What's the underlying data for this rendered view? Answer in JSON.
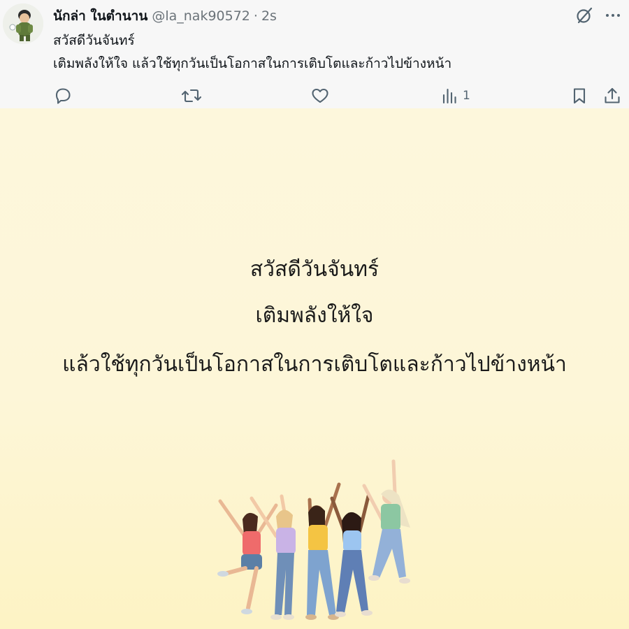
{
  "post": {
    "author": "นักล่า ในตำนาน",
    "handle": "@la_nak90572",
    "separator": "·",
    "time": "2s",
    "text_line1": "สวัสดีวันจันทร์",
    "text_line2": "เติมพลังให้ใจ แล้วใช้ทุกวันเป็นโอกาสในการเติบโตและก้าวไปข้างหน้า"
  },
  "top_icons": [
    "grok-icon",
    "more-icon"
  ],
  "actions": {
    "reply_count": "",
    "repost_count": "",
    "like_count": "",
    "views_count": "1"
  },
  "image": {
    "line1": "สวัสดีวันจันทร์",
    "line2": "เติมพลังให้ใจ",
    "line3": "แล้วใช้ทุกวันเป็นโอกาสในการเติบโตและก้าวไปข้างหน้า"
  },
  "colors": {
    "media_bg": "#fdf6d8",
    "text_dark": "#0f1419",
    "muted": "#536471"
  }
}
